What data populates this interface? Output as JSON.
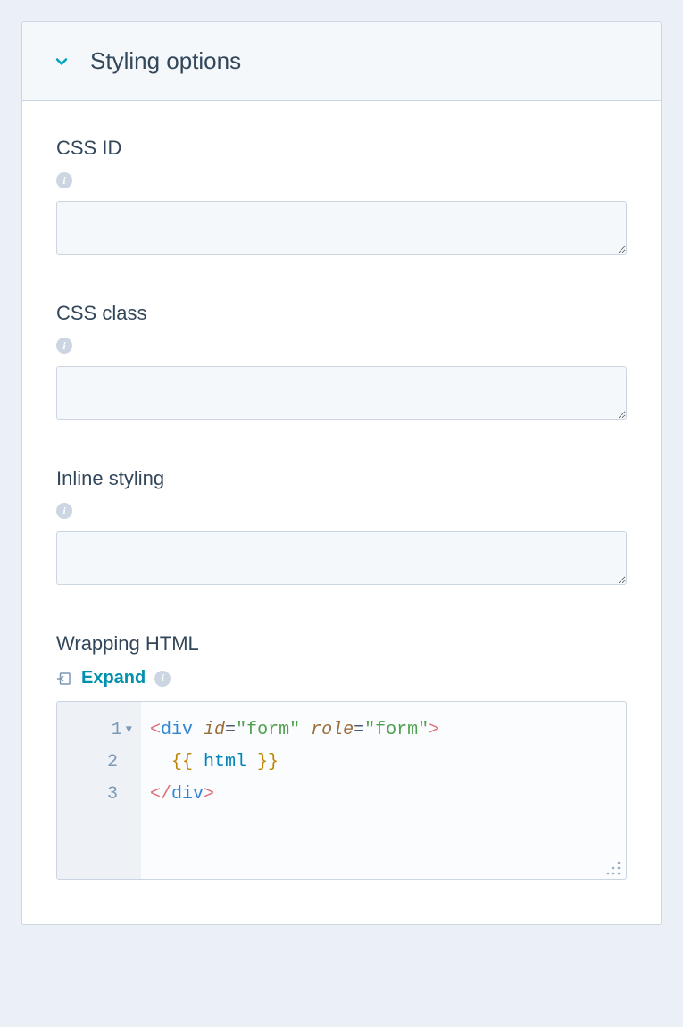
{
  "header": {
    "title": "Styling options"
  },
  "fields": {
    "css_id": {
      "label": "CSS ID",
      "value": ""
    },
    "css_class": {
      "label": "CSS class",
      "value": ""
    },
    "inline_styling": {
      "label": "Inline styling",
      "value": ""
    },
    "wrapping_html": {
      "label": "Wrapping HTML",
      "expand_label": "Expand",
      "code_lines": [
        {
          "n": "1",
          "foldable": true,
          "tokens": [
            {
              "t": "<",
              "c": "bracket"
            },
            {
              "t": "div ",
              "c": "tag"
            },
            {
              "t": "id",
              "c": "attr"
            },
            {
              "t": "=",
              "c": "op"
            },
            {
              "t": "\"form\"",
              "c": "str"
            },
            {
              "t": " ",
              "c": "op"
            },
            {
              "t": "role",
              "c": "attr"
            },
            {
              "t": "=",
              "c": "op"
            },
            {
              "t": "\"form\"",
              "c": "str"
            },
            {
              "t": ">",
              "c": "bracket"
            }
          ]
        },
        {
          "n": "2",
          "foldable": false,
          "tokens": [
            {
              "t": "  ",
              "c": "op"
            },
            {
              "t": "{{ ",
              "c": "tmpl"
            },
            {
              "t": "html",
              "c": "var"
            },
            {
              "t": " }}",
              "c": "tmpl"
            }
          ]
        },
        {
          "n": "3",
          "foldable": false,
          "tokens": [
            {
              "t": "</",
              "c": "bracket"
            },
            {
              "t": "div",
              "c": "tag"
            },
            {
              "t": ">",
              "c": "bracket"
            }
          ]
        }
      ]
    }
  }
}
